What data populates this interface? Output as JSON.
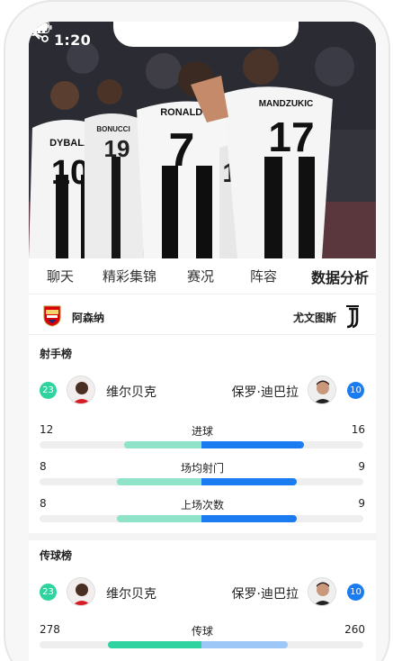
{
  "status_bar": {
    "time": "1:20"
  },
  "hero": {
    "jerseys": [
      {
        "name": "DYBALA",
        "number": "10"
      },
      {
        "name": "BONUCCI",
        "number": "19"
      },
      {
        "name": "RONALDO",
        "number": "7"
      },
      {
        "name": "",
        "number": "14"
      },
      {
        "name": "MANDZUKIC",
        "number": "17"
      }
    ]
  },
  "tabs": [
    {
      "label": "聊天",
      "active": false
    },
    {
      "label": "精彩集锦",
      "active": false
    },
    {
      "label": "赛况",
      "active": false
    },
    {
      "label": "阵容",
      "active": false
    },
    {
      "label": "数据分析",
      "active": true
    }
  ],
  "teams": {
    "home": {
      "name": "阿森纳"
    },
    "away": {
      "name": "尤文图斯"
    }
  },
  "sections": [
    {
      "title": "射手榜",
      "home_player": {
        "rank": "23",
        "name": "维尔贝克"
      },
      "away_player": {
        "rank": "10",
        "name": "保罗·迪巴拉"
      },
      "stats": [
        {
          "label": "进球",
          "home": "12",
          "away": "16",
          "home_share": 0.43,
          "away_share": 0.57
        },
        {
          "label": "场均射门",
          "home": "8",
          "away": "9",
          "home_share": 0.47,
          "away_share": 0.53
        },
        {
          "label": "上场次数",
          "home": "8",
          "away": "9",
          "home_share": 0.47,
          "away_share": 0.53
        }
      ]
    },
    {
      "title": "传球榜",
      "home_player": {
        "rank": "23",
        "name": "维尔贝克"
      },
      "away_player": {
        "rank": "10",
        "name": "保罗·迪巴拉"
      },
      "stats": [
        {
          "label": "传球",
          "home": "278",
          "away": "260",
          "home_share": 0.52,
          "away_share": 0.48
        }
      ]
    }
  ],
  "colors": {
    "home_badge": "#2ed3a0",
    "away_badge": "#1a7cf0",
    "home_bar_light": "#8ee3c8",
    "home_bar_strong": "#2ed3a0",
    "away_bar_strong": "#1a7cf0",
    "away_bar_light": "#9cc7f7",
    "track": "#eeeeee"
  }
}
